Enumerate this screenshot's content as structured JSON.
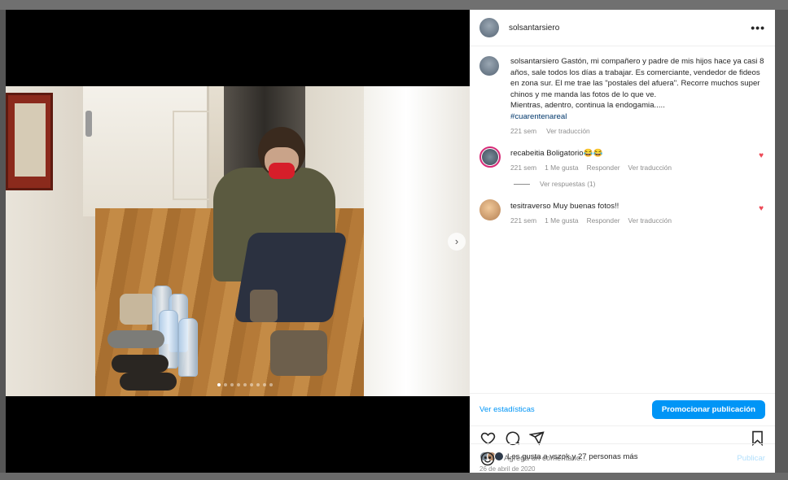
{
  "post": {
    "username": "solsantarsiero",
    "caption_user": "solsantarsiero",
    "caption_text": "Gastón, mi compañero y padre de mis hijos hace ya casi 8 años, sale todos los días a trabajar. Es comerciante, vendedor de fideos en zona sur. El me trae las \"postales del afuera\". Recorre muchos super chinos y me manda las fotos de lo que ve.",
    "caption_line2": "Mientras, adentro, continua la endogamia.....",
    "hashtag": "#cuarentenareal",
    "caption_age": "221 sem",
    "see_translation": "Ver traducción",
    "carousel_count": 9,
    "carousel_active": 0
  },
  "comments": [
    {
      "user": "recabeitia",
      "text": "Boligatorio😂😂",
      "age": "221 sem",
      "likes": "1 Me gusta",
      "reply": "Responder",
      "translate": "Ver traducción",
      "liked": true
    },
    {
      "user": "tesitraverso",
      "text": "Muy buenas fotos!!",
      "age": "221 sem",
      "likes": "1 Me gusta",
      "reply": "Responder",
      "translate": "Ver traducción",
      "liked": true
    }
  ],
  "replies_label": "Ver respuestas (1)",
  "stats": {
    "link": "Ver estadísticas",
    "promote": "Promocionar publicación"
  },
  "likes_summary": {
    "prefix": "Les gusta a ",
    "user": "vszok",
    "suffix": " y 27 personas más"
  },
  "date": "26 de abril de 2020",
  "composer": {
    "placeholder": "Agrega un comentario...",
    "publish": "Publicar"
  },
  "icons": {
    "more": "more-horizontal-icon",
    "like": "heart-icon",
    "comment": "comment-icon",
    "share": "share-icon",
    "save": "bookmark-icon",
    "emoji": "emoji-icon",
    "next": "chevron-right-icon"
  },
  "colors": {
    "accent": "#0095f6",
    "heart": "#ed4956",
    "muted": "#8e8e8e",
    "hashtag": "#00376b"
  }
}
